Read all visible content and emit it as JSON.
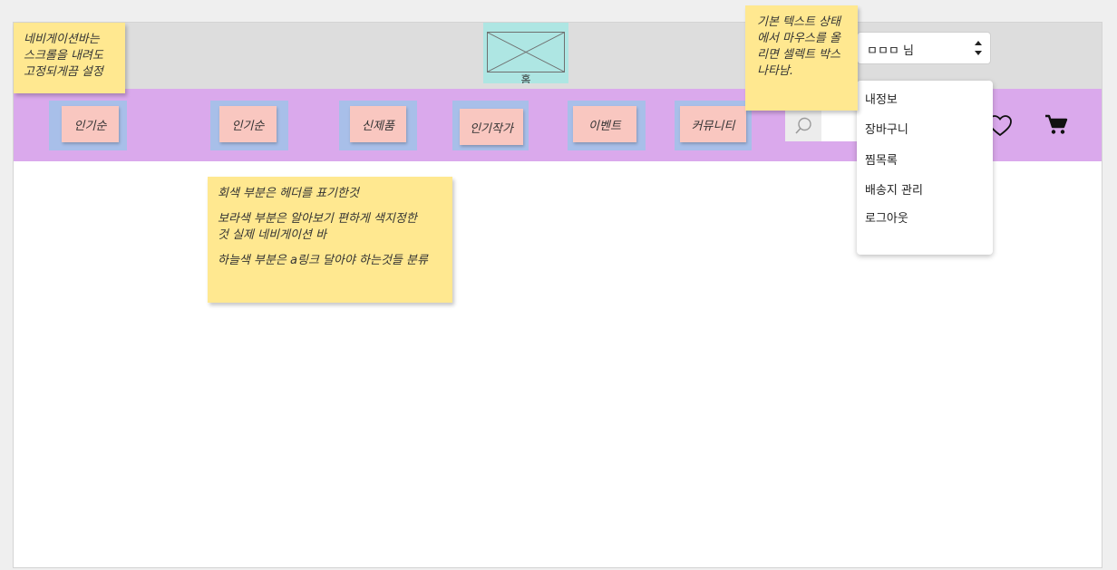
{
  "header": {
    "logo": {
      "caption": "홈"
    },
    "user_select": {
      "value": "ㅁㅁㅁ 님"
    }
  },
  "nav": {
    "items": [
      {
        "label": "인기순"
      },
      {
        "label": "인기순"
      },
      {
        "label": "신제품"
      },
      {
        "label": "인기작가"
      },
      {
        "label": "이벤트"
      },
      {
        "label": "커뮤니티"
      }
    ],
    "search": {
      "icon": "search-icon",
      "value": ""
    },
    "icons": {
      "heart": "heart-icon",
      "cart": "cart-icon"
    }
  },
  "dropdown": {
    "items": [
      "내정보",
      "장바구니",
      "찜목록",
      "배송지 관리",
      "로그아웃"
    ]
  },
  "notes": {
    "sticky_nav": "네비게이션바는\n스크롤을 내려도\n고정되게끔  설정",
    "select_hover": "기본 텍스트 상태\n에서 마우스를 올\n리면 셀렉트 박스\n나타남.",
    "legend": [
      "회색 부분은 헤더를 표기한것",
      "보라색 부분은 알아보기 편하게  색지정한\n것 실제 네비게이션 바",
      "하늘색 부분은 a링크 달아야 하는것들 분류"
    ]
  },
  "colors": {
    "header_bg": "#dddddd",
    "nav_bg": "#daa9ec",
    "link_area": "#a8bfe9",
    "nav_item": "#f9c7c0",
    "logo_bg": "#aee6e3",
    "note_bg": "#ffe890"
  }
}
